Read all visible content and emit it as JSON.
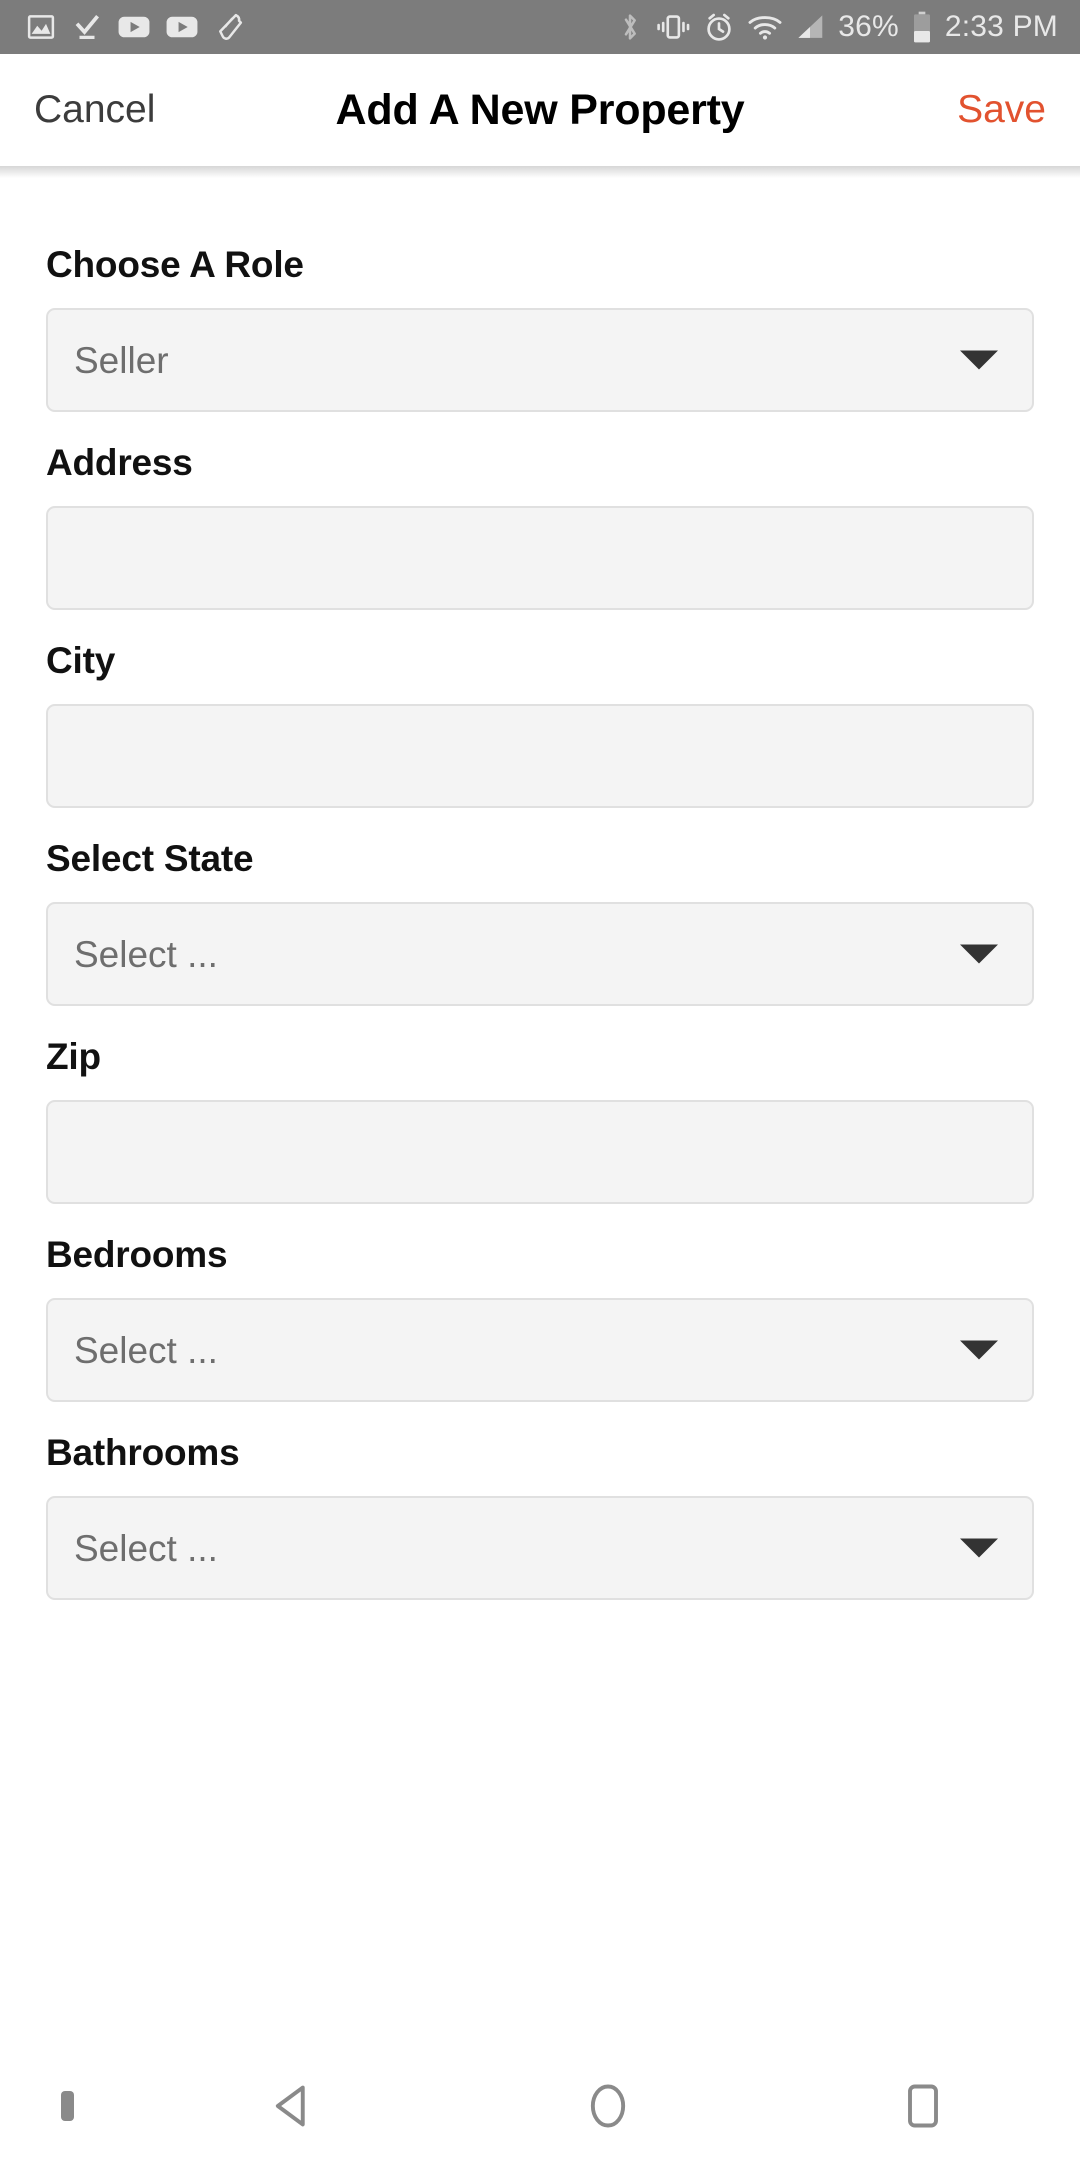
{
  "status_bar": {
    "left_icons": [
      "screenshot-icon",
      "download-complete-icon",
      "youtube-icon",
      "youtube-icon",
      "shoe-icon"
    ],
    "right_icons": [
      "bluetooth-icon",
      "vibrate-icon",
      "alarm-icon",
      "wifi-icon",
      "cellular-signal-icon"
    ],
    "battery_percent": "36%",
    "battery_icon": "battery-icon",
    "time": "2:33 PM",
    "background_color": "#7c7c7c",
    "text_color": "#e8e8e8"
  },
  "header": {
    "cancel_label": "Cancel",
    "title": "Add A New Property",
    "save_label": "Save",
    "save_color": "#e2522f",
    "title_color": "#000000"
  },
  "form": {
    "fields": [
      {
        "label": "Choose A Role",
        "value": "Seller",
        "type": "dropdown",
        "name": "role"
      },
      {
        "label": "Address",
        "value": "",
        "type": "text",
        "name": "address"
      },
      {
        "label": "City",
        "value": "",
        "type": "text",
        "name": "city"
      },
      {
        "label": "Select State",
        "value": "Select ...",
        "type": "dropdown",
        "name": "state"
      },
      {
        "label": "Zip",
        "value": "",
        "type": "text",
        "name": "zip"
      },
      {
        "label": "Bedrooms",
        "value": "Select ...",
        "type": "dropdown",
        "name": "bedrooms"
      },
      {
        "label": "Bathrooms",
        "value": "Select ...",
        "type": "dropdown",
        "name": "bathrooms"
      }
    ],
    "field_background": "#f4f4f4",
    "field_border": "#e0e0e0",
    "placeholder_color": "#6e6e6e"
  },
  "nav_bar": {
    "items": [
      "keyboard-indicator",
      "back-icon",
      "home-icon",
      "recents-icon"
    ],
    "icon_color": "#8a8a8a"
  }
}
